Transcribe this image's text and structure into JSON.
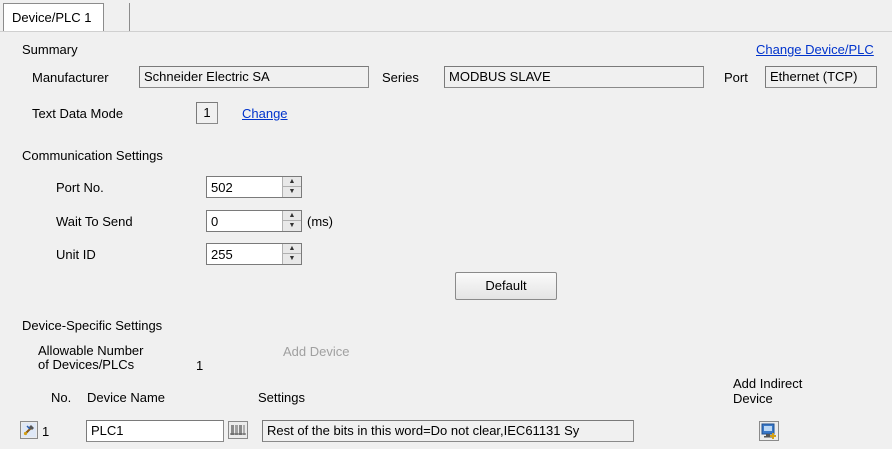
{
  "tab": {
    "label": "Device/PLC 1"
  },
  "summary": {
    "heading": "Summary",
    "change_device_link": "Change Device/PLC",
    "manufacturer_label": "Manufacturer",
    "manufacturer_value": "Schneider Electric SA",
    "series_label": "Series",
    "series_value": "MODBUS SLAVE",
    "port_label": "Port",
    "port_value": "Ethernet (TCP)",
    "text_data_mode_label": "Text Data Mode",
    "text_data_mode_value": "1",
    "change_link": "Change"
  },
  "communication": {
    "heading": "Communication Settings",
    "port_no_label": "Port No.",
    "port_no_value": "502",
    "wait_to_send_label": "Wait To Send",
    "wait_to_send_value": "0",
    "wait_to_send_unit": "(ms)",
    "unit_id_label": "Unit ID",
    "unit_id_value": "255",
    "default_button": "Default"
  },
  "device_specific": {
    "heading": "Device-Specific Settings",
    "allowable_label_line1": "Allowable Number",
    "allowable_label_line2": "of Devices/PLCs",
    "allowable_value": "1",
    "add_device": "Add Device",
    "col_no": "No.",
    "col_device_name": "Device Name",
    "col_settings": "Settings",
    "col_add_indirect_line1": "Add Indirect",
    "col_add_indirect_line2": "Device",
    "rows": [
      {
        "no": "1",
        "device_name": "PLC1",
        "settings": "Rest of the bits in this word=Do not clear,IEC61131 Sy"
      }
    ]
  },
  "colors": {
    "link": "#0033cc",
    "background": "#f0f0f0",
    "disabled": "#a0a0a0"
  }
}
